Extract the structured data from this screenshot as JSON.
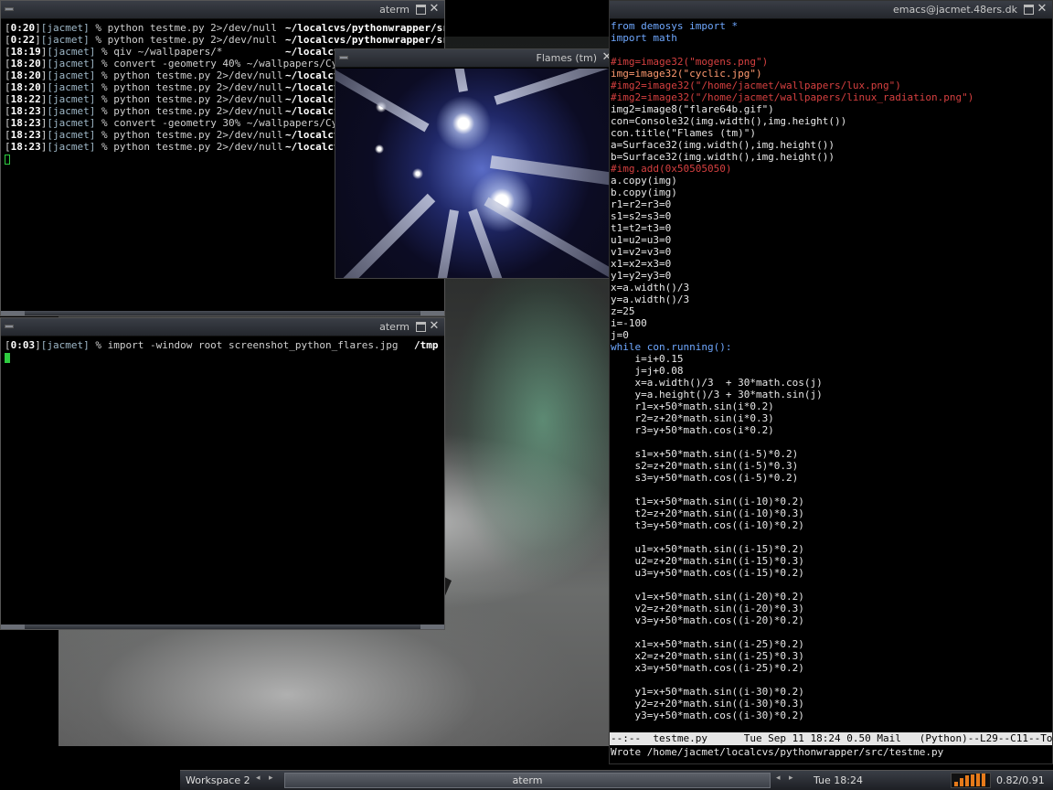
{
  "terminal_top": {
    "title": "aterm",
    "lines": [
      {
        "time": "0:20",
        "user": "[jacmet]",
        "cmd": " % python testme.py 2>/dev/null",
        "path": "~/localcvs/pythonwrapper/src"
      },
      {
        "time": "0:22",
        "user": "[jacmet]",
        "cmd": " % python testme.py 2>/dev/null",
        "path": "~/localcvs/pythonwrapper/src"
      },
      {
        "time": "18:19",
        "user": "[jacmet]",
        "cmd": " % qiv ~/wallpapers/*",
        "path": "~/localcvs"
      },
      {
        "time": "18:20",
        "user": "[jacmet]",
        "cmd": " % convert -geometry 40% ~/wallpapers/Cyclic1",
        "path": ""
      },
      {
        "time": "18:20",
        "user": "[jacmet]",
        "cmd": " % python testme.py 2>/dev/null",
        "path": "~/localcv"
      },
      {
        "time": "18:20",
        "user": "[jacmet]",
        "cmd": " % python testme.py 2>/dev/null",
        "path": "~/localcv"
      },
      {
        "time": "18:22",
        "user": "[jacmet]",
        "cmd": " % python testme.py 2>/dev/null",
        "path": "~/localcv"
      },
      {
        "time": "18:23",
        "user": "[jacmet]",
        "cmd": " % python testme.py 2>/dev/null",
        "path": "~/localcv"
      },
      {
        "time": "18:23",
        "user": "[jacmet]",
        "cmd": " % convert -geometry 30% ~/wallpapers/Cyclic1",
        "path": ""
      },
      {
        "time": "18:23",
        "user": "[jacmet]",
        "cmd": " % python testme.py 2>/dev/null",
        "path": "~/localcv"
      },
      {
        "time": "18:23",
        "user": "[jacmet]",
        "cmd": " % python testme.py 2>/dev/null",
        "path": "~/localcv"
      }
    ]
  },
  "terminal_bottom": {
    "title": "aterm",
    "time": "0:03",
    "user": "[jacmet]",
    "cmd": " % import -window root screenshot_python_flares.jpg",
    "path": "/tmp"
  },
  "flames_window": {
    "title": "Flames (tm)"
  },
  "emacs": {
    "title": "emacs@jacmet.48ers.dk",
    "code": [
      {
        "s": "from demosys import *",
        "style": "kw"
      },
      {
        "s": "import math",
        "style": "kw"
      },
      {
        "s": "",
        "style": ""
      },
      {
        "s": "#img=image32(\"mogens.png\")",
        "style": "cm"
      },
      {
        "s": "img=image32(\"cyclic.jpg\")",
        "style": "str"
      },
      {
        "s": "#img2=image32(\"/home/jacmet/wallpapers/lux.png\")",
        "style": "cm"
      },
      {
        "s": "#img2=image32(\"/home/jacmet/wallpapers/linux_radiation.png\")",
        "style": "cm"
      },
      {
        "s": "img2=image8(\"flare64b.gif\")",
        "style": ""
      },
      {
        "s": "con=Console32(img.width(),img.height())",
        "style": ""
      },
      {
        "s": "con.title(\"Flames (tm)\")",
        "style": ""
      },
      {
        "s": "a=Surface32(img.width(),img.height())",
        "style": ""
      },
      {
        "s": "b=Surface32(img.width(),img.height())",
        "style": ""
      },
      {
        "s": "#img.add(0x50505050)",
        "style": "cm"
      },
      {
        "s": "a.copy(img)",
        "style": ""
      },
      {
        "s": "b.copy(img)",
        "style": ""
      },
      {
        "s": "r1=r2=r3=0",
        "style": ""
      },
      {
        "s": "s1=s2=s3=0",
        "style": ""
      },
      {
        "s": "t1=t2=t3=0",
        "style": ""
      },
      {
        "s": "u1=u2=u3=0",
        "style": ""
      },
      {
        "s": "v1=v2=v3=0",
        "style": ""
      },
      {
        "s": "x1=x2=x3=0",
        "style": ""
      },
      {
        "s": "y1=y2=y3=0",
        "style": ""
      },
      {
        "s": "x=a.width()/3",
        "style": ""
      },
      {
        "s": "y=a.width()/3",
        "style": ""
      },
      {
        "s": "z=25",
        "style": ""
      },
      {
        "s": "i=-100",
        "style": ""
      },
      {
        "s": "j=0",
        "style": ""
      },
      {
        "s": "while con.running():",
        "style": "kw"
      },
      {
        "s": "    i=i+0.15",
        "style": ""
      },
      {
        "s": "    j=j+0.08",
        "style": ""
      },
      {
        "s": "    x=a.width()/3  + 30*math.cos(j)",
        "style": ""
      },
      {
        "s": "    y=a.height()/3 + 30*math.sin(j)",
        "style": ""
      },
      {
        "s": "    r1=x+50*math.sin(i*0.2)",
        "style": ""
      },
      {
        "s": "    r2=z+20*math.sin(i*0.3)",
        "style": ""
      },
      {
        "s": "    r3=y+50*math.cos(i*0.2)",
        "style": ""
      },
      {
        "s": "",
        "style": ""
      },
      {
        "s": "    s1=x+50*math.sin((i-5)*0.2)",
        "style": ""
      },
      {
        "s": "    s2=z+20*math.sin((i-5)*0.3)",
        "style": ""
      },
      {
        "s": "    s3=y+50*math.cos((i-5)*0.2)",
        "style": ""
      },
      {
        "s": "",
        "style": ""
      },
      {
        "s": "    t1=x+50*math.sin((i-10)*0.2)",
        "style": ""
      },
      {
        "s": "    t2=z+20*math.sin((i-10)*0.3)",
        "style": ""
      },
      {
        "s": "    t3=y+50*math.cos((i-10)*0.2)",
        "style": ""
      },
      {
        "s": "",
        "style": ""
      },
      {
        "s": "    u1=x+50*math.sin((i-15)*0.2)",
        "style": ""
      },
      {
        "s": "    u2=z+20*math.sin((i-15)*0.3)",
        "style": ""
      },
      {
        "s": "    u3=y+50*math.cos((i-15)*0.2)",
        "style": ""
      },
      {
        "s": "",
        "style": ""
      },
      {
        "s": "    v1=x+50*math.sin((i-20)*0.2)",
        "style": ""
      },
      {
        "s": "    v2=z+20*math.sin((i-20)*0.3)",
        "style": ""
      },
      {
        "s": "    v3=y+50*math.cos((i-20)*0.2)",
        "style": ""
      },
      {
        "s": "",
        "style": ""
      },
      {
        "s": "    x1=x+50*math.sin((i-25)*0.2)",
        "style": ""
      },
      {
        "s": "    x2=z+20*math.sin((i-25)*0.3)",
        "style": ""
      },
      {
        "s": "    x3=y+50*math.cos((i-25)*0.2)",
        "style": ""
      },
      {
        "s": "",
        "style": ""
      },
      {
        "s": "    y1=x+50*math.sin((i-30)*0.2)",
        "style": ""
      },
      {
        "s": "    y2=z+20*math.sin((i-30)*0.3)",
        "style": ""
      },
      {
        "s": "    y3=y+50*math.cos((i-30)*0.2)",
        "style": ""
      }
    ],
    "modeline": "--:--  testme.py      Tue Sep 11 18:24 0.50 Mail   (Python)--L29--C11--Top--------",
    "minibuffer": "Wrote /home/jacmet/localcvs/pythonwrapper/src/testme.py"
  },
  "taskbar": {
    "workspace": "Workspace 2",
    "arrow_left": "◂",
    "arrow_right": "▸",
    "task_label": "aterm",
    "clock": "Tue 18:24",
    "load_text": "0.82/0.91",
    "accent_color": "#e67a1a"
  }
}
